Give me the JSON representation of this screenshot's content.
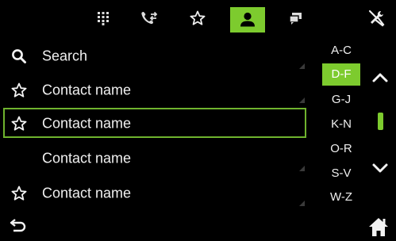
{
  "top_tabs": [
    {
      "icon": "keypad-icon",
      "active": false
    },
    {
      "icon": "call-log-icon",
      "active": false
    },
    {
      "icon": "favorite-star-icon",
      "active": false
    },
    {
      "icon": "contacts-person-icon",
      "active": true
    },
    {
      "icon": "messages-icon",
      "active": false
    }
  ],
  "settings_icon": "tools-icon",
  "list": {
    "search_label": "Search",
    "rows": [
      {
        "label": "Contact name",
        "starred": true,
        "selected": false
      },
      {
        "label": "Contact name",
        "starred": true,
        "selected": true
      },
      {
        "label": "Contact name",
        "starred": false,
        "selected": false
      },
      {
        "label": "Contact name",
        "starred": true,
        "selected": false
      }
    ]
  },
  "alphabet": [
    "A-C",
    "D-F",
    "G-J",
    "K-N",
    "O-R",
    "S-V",
    "W-Z"
  ],
  "alphabet_active": "D-F",
  "colors": {
    "accent": "#7dcb2e",
    "background": "#000000",
    "text": "#f0f0f0"
  }
}
